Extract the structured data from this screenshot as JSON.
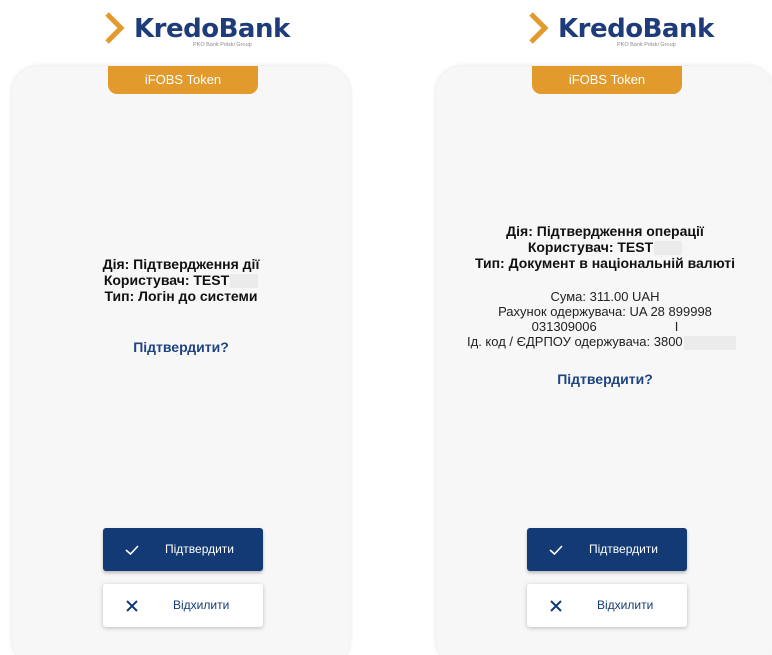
{
  "brand": {
    "name": "KredoBank",
    "subtitle": "PKO Bank Polski Group",
    "chevron_color": "#e39a2a",
    "text_color": "#1f3c7a"
  },
  "token_tab": "iFOBS Token",
  "colors": {
    "primary": "#143a75",
    "accent": "#e19a2b",
    "card_bg": "#f7f7f7"
  },
  "screens": [
    {
      "action": "Дія: Підтвердження дії",
      "user": "Користувач: TEST",
      "type": "Тип: Логін до системи",
      "question": "Підтвердити?",
      "confirm_icon": "check-icon",
      "confirm_label": "Підтвердити",
      "reject_icon": "close-icon",
      "reject_label": "Відхилити"
    },
    {
      "action": "Дія: Підтвердження операції",
      "user": "Користувач: TEST",
      "type": "Тип: Документ в національній валюті",
      "amount": "Сума: 311.00 UAH",
      "account": "Рахунок одержувача: UA 28 899998",
      "account_cont": "031309006",
      "account_cont2": "I",
      "recipient_id": "Ід. код / ЄДРПОУ одержувача: 3800",
      "question": "Підтвердити?",
      "confirm_icon": "check-icon",
      "confirm_label": "Підтвердити",
      "reject_icon": "close-icon",
      "reject_label": "Відхилити"
    }
  ]
}
